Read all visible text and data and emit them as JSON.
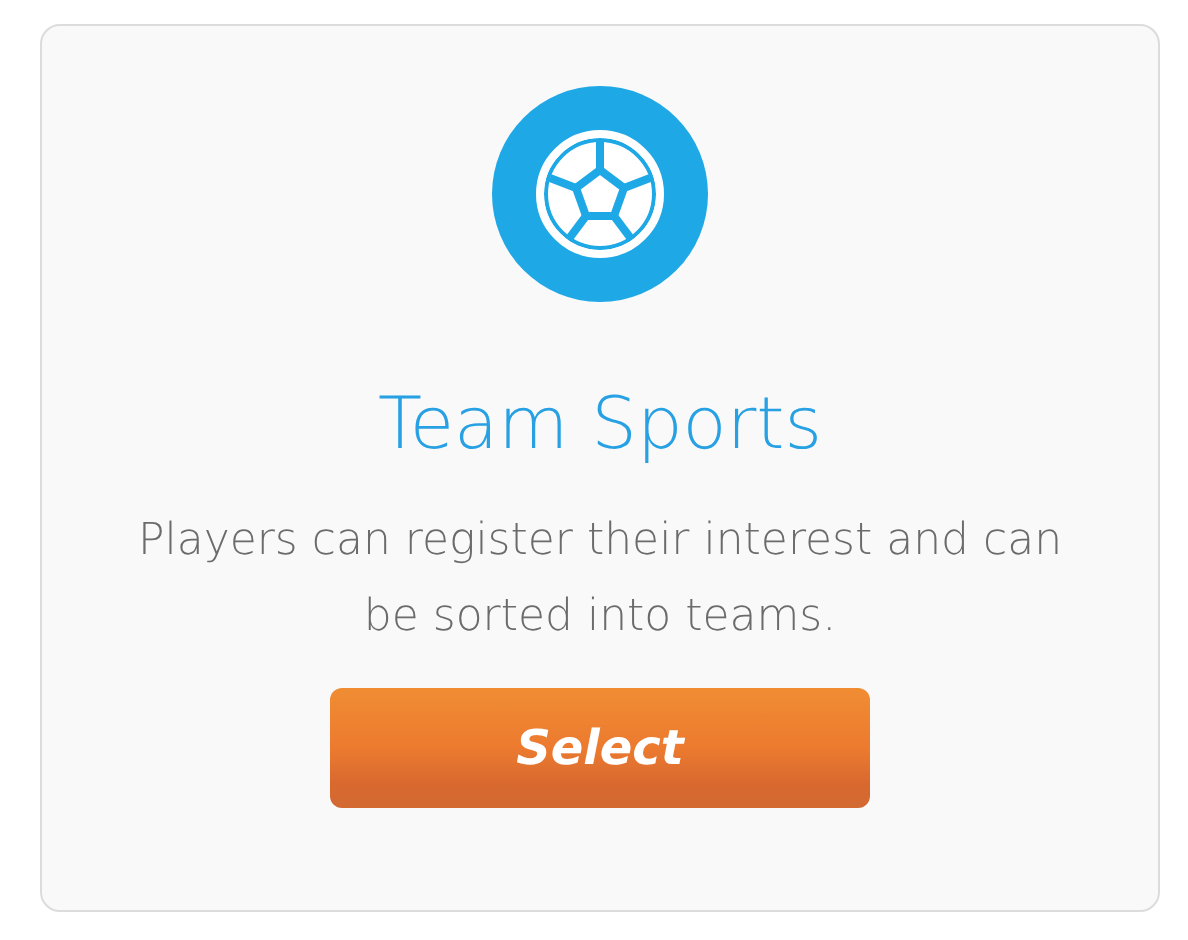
{
  "card": {
    "title": "Team Sports",
    "description": "Players can register their interest and can be sorted into teams.",
    "button": "Select"
  }
}
